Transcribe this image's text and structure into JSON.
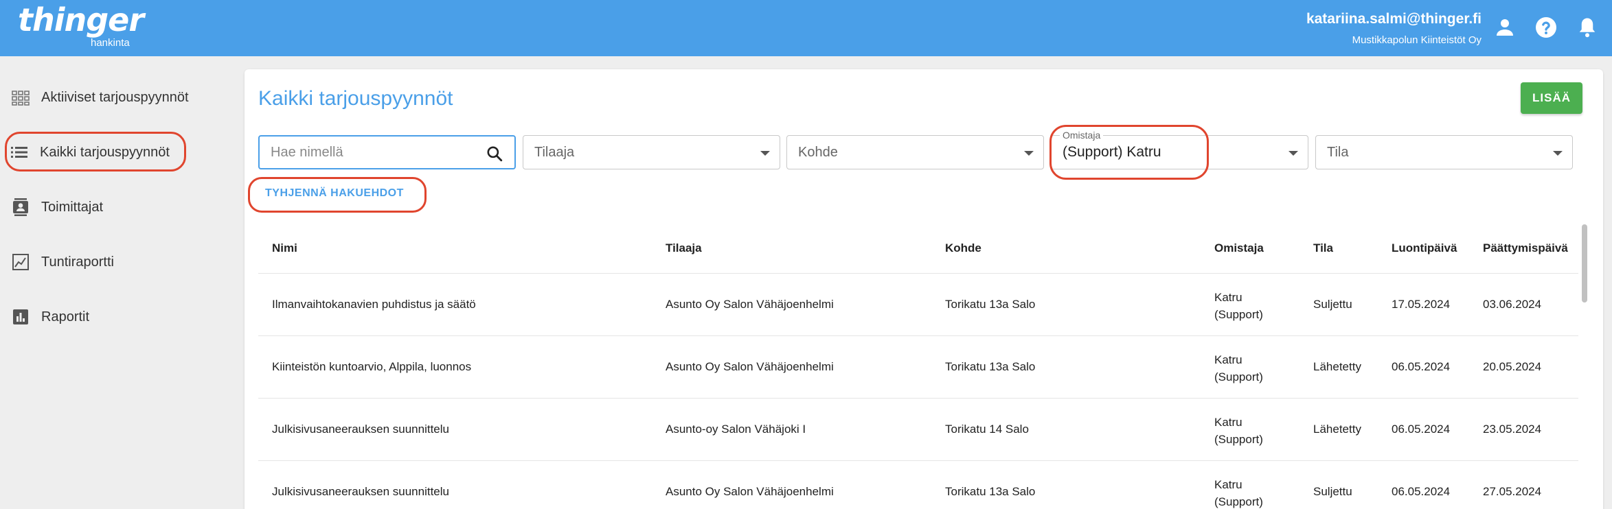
{
  "brand": {
    "name": "thinger",
    "sub": "hankinta"
  },
  "user": {
    "email": "katariina.salmi@thinger.fi",
    "company": "Mustikkapolun Kiinteistöt Oy"
  },
  "topicons": [
    "account-icon",
    "help-icon",
    "bell-icon"
  ],
  "sidebar": {
    "items": [
      {
        "label": "Aktiiviset tarjouspyynnöt",
        "icon": "grid-icon"
      },
      {
        "label": "Kaikki tarjouspyynnöt",
        "icon": "list-icon",
        "active": true
      },
      {
        "label": "Toimittajat",
        "icon": "contacts-icon"
      },
      {
        "label": "Tuntiraportti",
        "icon": "chart-icon"
      },
      {
        "label": "Raportit",
        "icon": "bar-chart-icon"
      }
    ]
  },
  "main": {
    "title": "Kaikki tarjouspyynnöt",
    "add_label": "LISÄÄ",
    "filters": {
      "search_placeholder": "Hae nimellä",
      "tilaaja": "Tilaaja",
      "kohde": "Kohde",
      "omistaja_label": "Omistaja",
      "omistaja_value": "(Support) Katru",
      "tila": "Tila"
    },
    "clear_label": "TYHJENNÄ HAKUEHDOT",
    "table": {
      "headers": [
        "Nimi",
        "Tilaaja",
        "Kohde",
        "Omistaja",
        "Tila",
        "Luontipäivä",
        "Päättymispäivä"
      ],
      "rows": [
        {
          "nimi": "Ilmanvaihtokanavien puhdistus ja säätö",
          "tilaaja": "Asunto Oy Salon Vähäjoenhelmi",
          "kohde": "Torikatu 13a Salo",
          "omistaja1": "Katru",
          "omistaja2": "(Support)",
          "tila": "Suljettu",
          "luonti": "17.05.2024",
          "paattyminen": "03.06.2024"
        },
        {
          "nimi": "Kiinteistön kuntoarvio, Alppila, luonnos",
          "tilaaja": "Asunto Oy Salon Vähäjoenhelmi",
          "kohde": "Torikatu 13a Salo",
          "omistaja1": "Katru",
          "omistaja2": "(Support)",
          "tila": "Lähetetty",
          "luonti": "06.05.2024",
          "paattyminen": "20.05.2024"
        },
        {
          "nimi": "Julkisivusaneerauksen suunnittelu",
          "tilaaja": "Asunto-oy Salon Vähäjoki I",
          "kohde": "Torikatu 14 Salo",
          "omistaja1": "Katru",
          "omistaja2": "(Support)",
          "tila": "Lähetetty",
          "luonti": "06.05.2024",
          "paattyminen": "23.05.2024"
        },
        {
          "nimi": "Julkisivusaneerauksen suunnittelu",
          "tilaaja": "Asunto Oy Salon Vähäjoenhelmi",
          "kohde": "Torikatu 13a Salo",
          "omistaja1": "Katru",
          "omistaja2": "(Support)",
          "tila": "Suljettu",
          "luonti": "06.05.2024",
          "paattyminen": "27.05.2024"
        }
      ]
    }
  },
  "colors": {
    "brand_blue": "#4a9fe8",
    "add_green": "#4caf50",
    "highlight_red": "#e0452e"
  }
}
